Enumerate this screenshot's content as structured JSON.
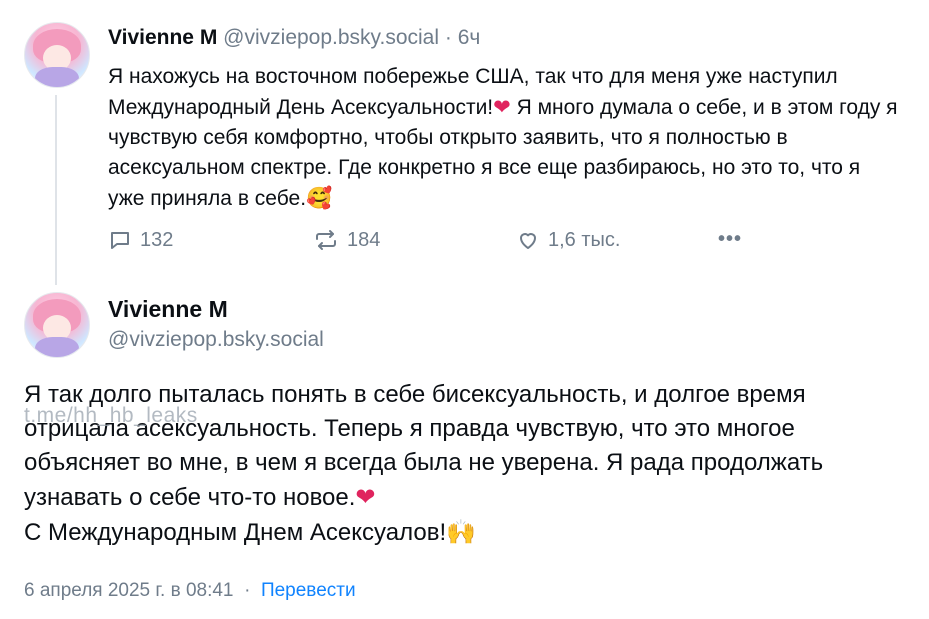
{
  "post1": {
    "author_name": "Vivienne M",
    "handle": "@vivziepop.bsky.social",
    "separator": "·",
    "time": "6ч",
    "text_part1": "Я нахожусь на восточном побережье США, так что для меня уже наступил Международный День Асексуальности!",
    "text_part2": "Я много думала о себе, и в этом году я чувствую себя комфортно, чтобы открыто заявить, что я полностью в асексуальном спектре. Где конкретно я все еще разбираюсь, но это то, что я уже приняла в себе.",
    "emoji_heart": "❤",
    "emoji_smile": "🥰",
    "actions": {
      "replies": "132",
      "reposts": "184",
      "likes": "1,6 тыс.",
      "more": "•••"
    }
  },
  "post2": {
    "author_name": "Vivienne M",
    "handle": "@vivziepop.bsky.social",
    "text_part1": "Я так долго пыталась понять в себе бисексуальность, и долгое время отрицала асексуальность. Теперь я правда чувствую, что это многое объясняет во мне, в чем я всегда была не уверена. Я рада продолжать узнавать о себе что-то новое.",
    "emoji_heart": "❤",
    "text_part2": "С Международным Днем Асексуалов!",
    "emoji_hands": "🙌",
    "date": "6 апреля 2025 г. в 08:41",
    "separator": "·",
    "translate_label": "Перевести"
  },
  "watermark": "t.me/hh_hb_leaks",
  "colors": {
    "text": "#0b0f14",
    "muted": "#6f7c8a",
    "link": "#1083fe",
    "heart": "#e0245e"
  },
  "icons": {
    "reply": "reply-bubble-icon",
    "repost": "repost-arrows-icon",
    "like": "heart-outline-icon",
    "more": "more-dots-icon"
  }
}
